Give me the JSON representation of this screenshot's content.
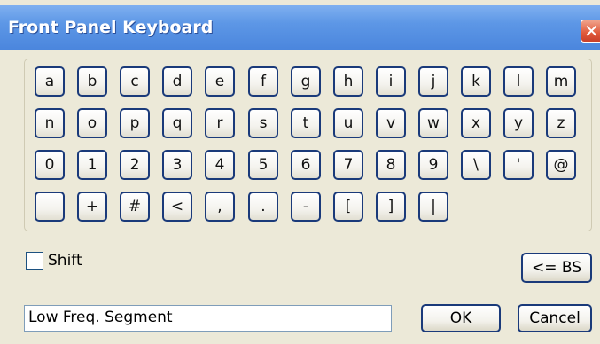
{
  "window": {
    "title": "Front Panel Keyboard",
    "close_glyph": "✕"
  },
  "keyboard": {
    "rows": [
      [
        "a",
        "b",
        "c",
        "d",
        "e",
        "f",
        "g",
        "h",
        "i",
        "j",
        "k",
        "l",
        "m"
      ],
      [
        "n",
        "o",
        "p",
        "q",
        "r",
        "s",
        "t",
        "u",
        "v",
        "w",
        "x",
        "y",
        "z"
      ],
      [
        "0",
        "1",
        "2",
        "3",
        "4",
        "5",
        "6",
        "7",
        "8",
        "9",
        "\\",
        "'",
        "@"
      ],
      [
        " ",
        "+",
        "#",
        "<",
        ",",
        ".",
        "-",
        "[",
        "]",
        "|"
      ]
    ]
  },
  "shift": {
    "label": "Shift",
    "checked": false
  },
  "buttons": {
    "backspace": "<= BS",
    "ok": "OK",
    "cancel": "Cancel"
  },
  "input": {
    "value": "Low Freq. Segment"
  },
  "colors": {
    "titlebar": "#4b86dd",
    "key_border": "#1a3a7a",
    "dialog_bg": "#ece9d8",
    "close_button": "#e0593a"
  }
}
